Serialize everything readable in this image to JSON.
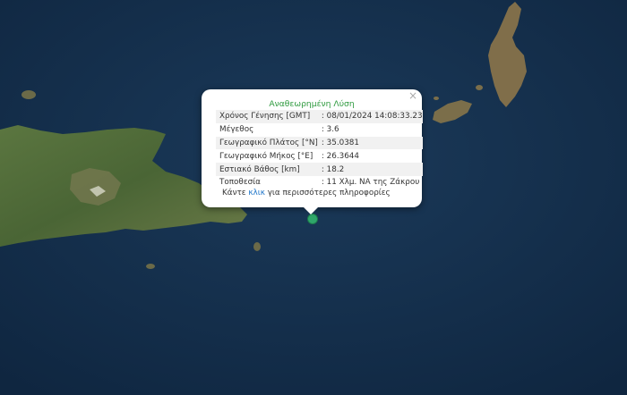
{
  "popup": {
    "title": "Αναθεωρημένη Λύση",
    "close_symbol": "×",
    "rows": [
      {
        "label": "Χρόνος Γένησης [GMT]",
        "value": ": 08/01/2024 14:08:33.23"
      },
      {
        "label": "Μέγεθος",
        "value": ": 3.6"
      },
      {
        "label": "Γεωγραφικό Πλάτος [°N]",
        "value": ": 35.0381"
      },
      {
        "label": "Γεωγραφικό Μήκος [°E]",
        "value": ": 26.3644"
      },
      {
        "label": "Εστιακό Βάθος [km]",
        "value": ": 18.2"
      },
      {
        "label": "Τοποθεσία",
        "value": ": 11 Χλμ. ΝΑ της Ζάκρου"
      }
    ],
    "more_prefix": "Κάντε",
    "more_link": "κλικ",
    "more_suffix": "για περισσότερες πληροφορίες"
  },
  "colors": {
    "sea": "#14304f",
    "land": "#4f6a38",
    "title_green": "#2e9a3e",
    "link_blue": "#1a73c8",
    "marker": "#2fa66a"
  },
  "icons": {
    "close": "close-icon",
    "marker": "earthquake-marker-icon"
  }
}
